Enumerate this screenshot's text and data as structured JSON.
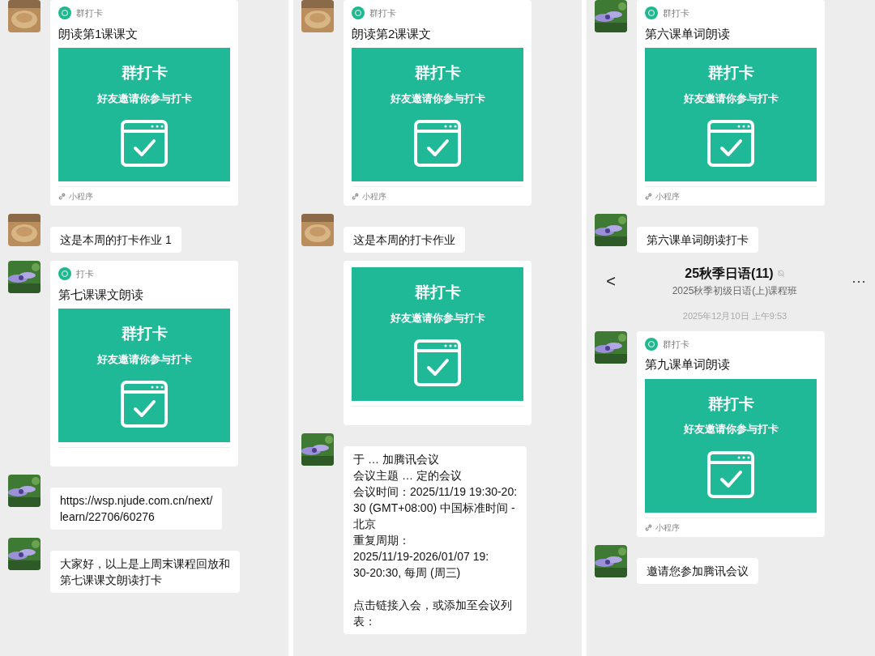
{
  "columns": [
    {
      "messages": [
        {
          "kind": "card",
          "avatar": {
            "kind": "tan"
          },
          "app_label": "群打卡",
          "title": "朗读第1课课文",
          "banner_title": "群打卡",
          "banner_subtitle": "好友邀请你参与打卡",
          "footer": "小程序"
        },
        {
          "kind": "text",
          "avatar": {
            "kind": "tan"
          },
          "lines": [
            "这是本周的打卡作业 1"
          ]
        },
        {
          "kind": "card",
          "avatar": {
            "kind": "flower"
          },
          "app_label": "打卡",
          "title": "第七课课文朗读",
          "banner_title": "群打卡",
          "banner_subtitle": "好友邀请你参与打卡"
        },
        {
          "kind": "text",
          "avatar": {
            "kind": "flower"
          },
          "lines": [
            "https://wsp.njude.com.cn/next/",
            "learn/22706/60276"
          ]
        },
        {
          "kind": "text",
          "avatar": {
            "kind": "flower"
          },
          "lines": [
            "大家好，以上是上周末课程回放和",
            "第七课课文朗读打卡"
          ]
        }
      ]
    },
    {
      "messages": [
        {
          "kind": "card",
          "avatar": {
            "kind": "tan"
          },
          "app_label": "群打卡",
          "title": "朗读第2课课文",
          "banner_title": "群打卡",
          "banner_subtitle": "好友邀请你参与打卡",
          "footer": "小程序"
        },
        {
          "kind": "text",
          "avatar": {
            "kind": "tan"
          },
          "lines": [
            "这是本周的打卡作业"
          ]
        },
        {
          "kind": "card",
          "banner_title": "群打卡",
          "banner_subtitle": "好友邀请你参与打卡"
        },
        {
          "kind": "text",
          "avatar": {
            "kind": "flower"
          },
          "lines": [
            "于 … 加腾讯会议",
            "会议主题 … 定的会议",
            "会议时间：2025/11/19 19:30-20:",
            "30 (GMT+08:00) 中国标准时间 -",
            "北京",
            "重复周期：",
            "2025/11/19-2026/01/07 19:",
            "30-20:30, 每周 (周三)"
          ],
          "extra_lines": [
            "点击链接入会，或添加至会议列",
            "表："
          ]
        }
      ]
    },
    {
      "messages": [
        {
          "kind": "card",
          "avatar": {
            "kind": "flower"
          },
          "app_label": "群打卡",
          "title": "第六课单词朗读",
          "banner_title": "群打卡",
          "banner_subtitle": "好友邀请你参与打卡",
          "footer": "小程序"
        },
        {
          "kind": "text",
          "avatar": {
            "kind": "flower"
          },
          "lines": [
            "第六课单词朗读打卡"
          ]
        },
        {
          "kind": "header",
          "title": "25秋季日语(11)",
          "subtitle": "2025秋季初级日语(上)课程班",
          "back": "<",
          "more": "···"
        },
        {
          "kind": "timestamp",
          "text": "2025年12月10日 上午9:53"
        },
        {
          "kind": "card",
          "avatar": {
            "kind": "flower"
          },
          "app_label": "群打卡",
          "title": "第九课单词朗读",
          "banner_title": "群打卡",
          "banner_subtitle": "好友邀请你参与打卡",
          "footer": "小程序"
        },
        {
          "kind": "text",
          "avatar": {
            "kind": "flower"
          },
          "lines": [
            "邀请您参加腾讯会议"
          ]
        }
      ]
    }
  ]
}
